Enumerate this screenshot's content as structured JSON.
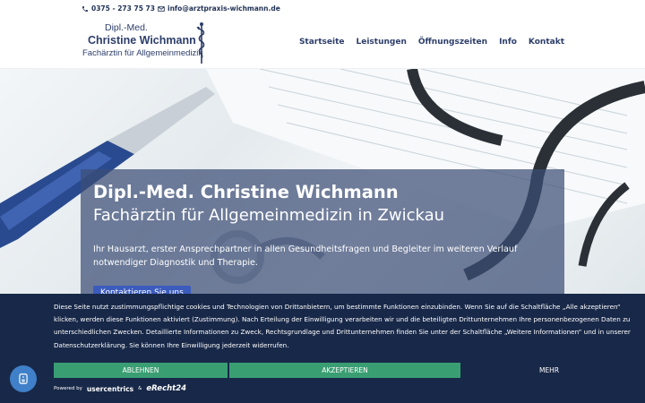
{
  "topbar": {
    "phone": "0375 - 273 75 73",
    "email": "info@arztpraxis-wichmann.de"
  },
  "logo": {
    "line1": "Dipl.-Med.",
    "line2": "Christine Wichmann",
    "line3": "Fachärztin für Allgemeinmedizin"
  },
  "nav": [
    "Startseite",
    "Leistungen",
    "Öffnungszeiten",
    "Info",
    "Kontakt"
  ],
  "hero": {
    "title": "Dipl.-Med. Christine Wichmann",
    "subtitle": "Fachärztin für Allgemeinmedizin in Zwickau",
    "text": "Ihr Hausarzt, erster Ansprechpartner in allen Gesundheitsfragen und Begleiter im weiteren Verlauf notwendiger Diagnostik und Therapie.",
    "button": "Kontaktieren Sie uns"
  },
  "consent": {
    "text": "Diese Seite nutzt zustimmungspflichtige cookies und Technologien von Drittanbietern, um bestimmte Funktionen einzubinden. Wenn Sie auf die Schaltfläche „Alle akzeptieren“ klicken, werden diese Funktionen aktiviert (Zustimmung). Nach Erteilung der Einwilligung verarbeiten wir und die beteiligten Drittunternehmen Ihre personenbezogenen Daten zu unterschiedlichen Zwecken. Detaillierte Informationen zu Zweck, Rechtsgrundlage und Drittunternehmen finden Sie unter der Schaltfläche „Weitere Informationen“ und in unserer Datenschutzerklärung. Sie können Ihre Einwilligung jederzeit widerrufen.",
    "reject": "ABLEHNEN",
    "accept": "AKZEPTIEREN",
    "more": "MEHR",
    "powered_by": "Powered by",
    "brand1": "usercentrics",
    "amp": "&",
    "brand2": "eRecht24"
  },
  "colors": {
    "brand": "#2d3e6b",
    "consent_bg": "#182848",
    "button_green": "#3a9e73",
    "hero_overlay": "#3c4e76"
  }
}
